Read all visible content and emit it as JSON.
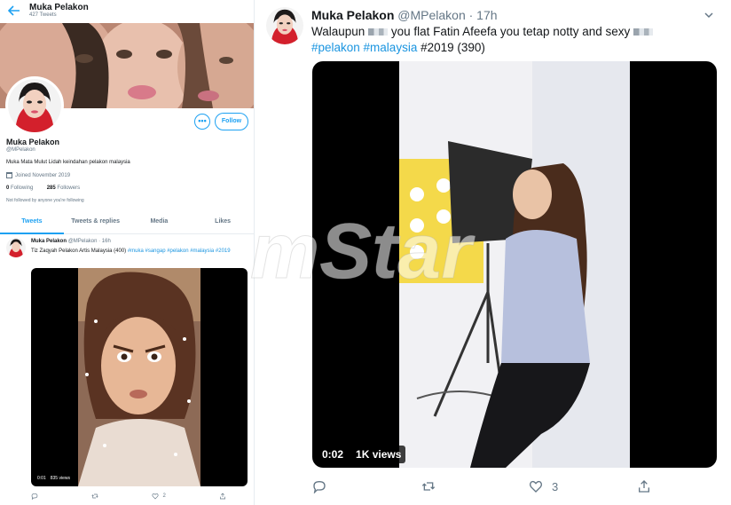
{
  "profile": {
    "header_name": "Muka Pelakon",
    "tweet_count": "427 Tweets",
    "name": "Muka Pelakon",
    "handle": "@MPelakon",
    "bio": "Muka Mata Mulut Lidah keindahan pelakon malaysia",
    "joined": "Joined November 2019",
    "following_count": "0",
    "following_label": "Following",
    "followers_count": "285",
    "followers_label": "Followers",
    "not_followed": "Not followed by anyone you're following",
    "more_label": "•••",
    "follow_label": "Follow"
  },
  "tabs": [
    {
      "label": "Tweets",
      "active": true
    },
    {
      "label": "Tweets & replies",
      "active": false
    },
    {
      "label": "Media",
      "active": false
    },
    {
      "label": "Likes",
      "active": false
    }
  ],
  "mini_tweet": {
    "name": "Muka Pelakon",
    "meta": "@MPelakon · 16h",
    "text": "Tiz Zaqyah Pelakon Artis Malaysia (400)",
    "tags": "#muka #sangap #pelakon #malaysia",
    "tag_year": "#2019",
    "video_time": "0:01",
    "video_views": "835 views",
    "likes": "2"
  },
  "tweet": {
    "name": "Muka Pelakon",
    "meta": "@MPelakon · 17h",
    "text_a": "Walaupun",
    "text_b": "you flat Fatin Afeefa you tetap notty and sexy",
    "tags": "#pelakon #malaysia",
    "tail": "#2019 (390)",
    "video_time": "0:02",
    "video_views": "1K views",
    "likes": "3"
  },
  "icons": {
    "back": "back-arrow-icon",
    "calendar": "calendar-icon",
    "reply": "reply-icon",
    "retweet": "retweet-icon",
    "like": "heart-icon",
    "share": "share-icon",
    "caret": "chevron-down-icon"
  },
  "colors": {
    "accent": "#1da1f2",
    "muted": "#657786",
    "text": "#14171a"
  },
  "watermark": "mStar"
}
